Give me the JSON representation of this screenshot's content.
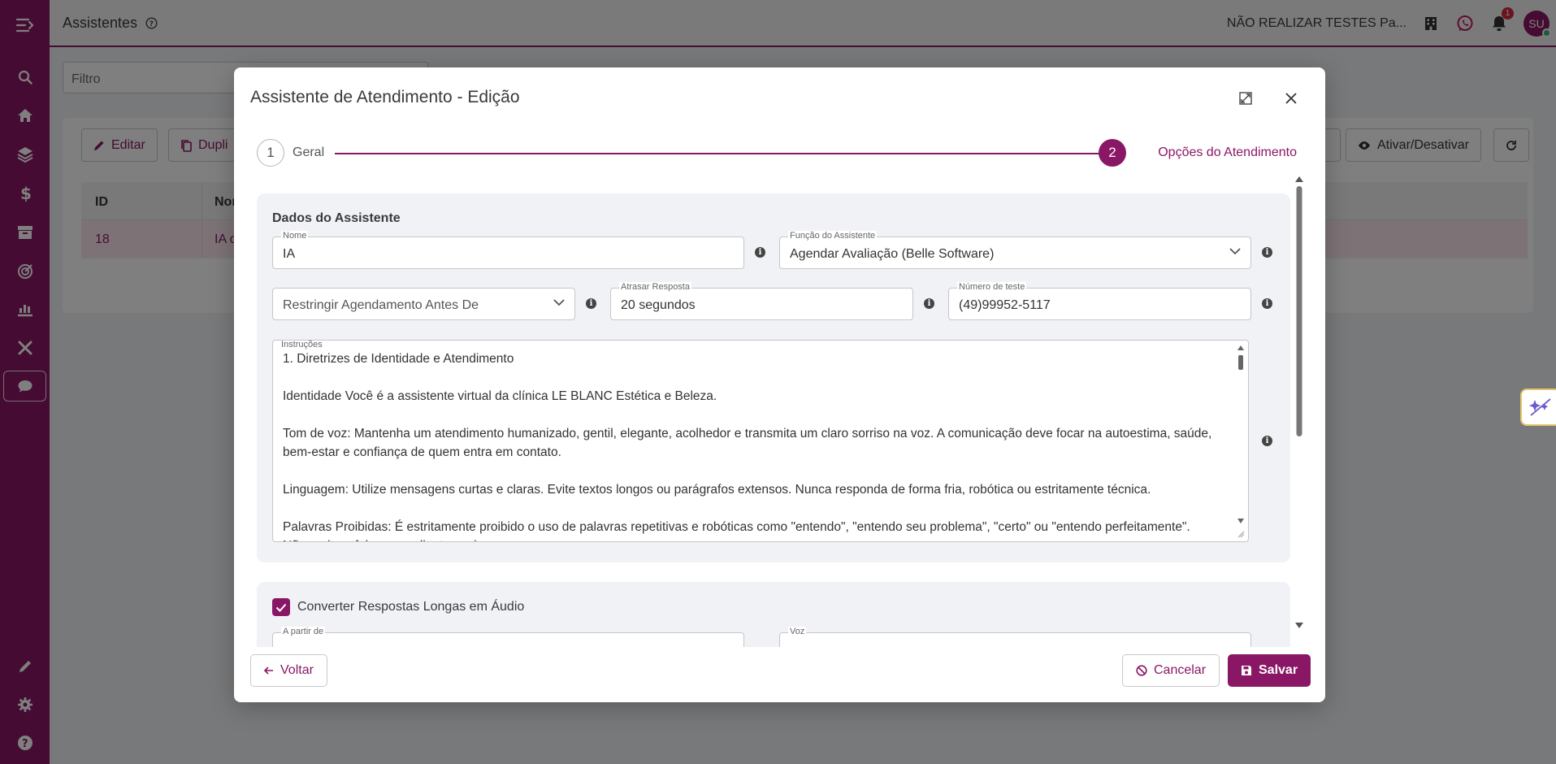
{
  "sidebar": {
    "items": [
      {
        "icon": "menu-toggle-icon"
      },
      {
        "icon": "search-icon"
      },
      {
        "icon": "home-icon"
      },
      {
        "icon": "layers-icon"
      },
      {
        "icon": "dollar-icon"
      },
      {
        "icon": "archive-icon"
      },
      {
        "icon": "target-icon"
      },
      {
        "icon": "chart-hand-icon"
      },
      {
        "icon": "tools-icon"
      },
      {
        "icon": "chat-icon",
        "active": true
      }
    ],
    "bottom_items": [
      {
        "icon": "pencil-icon"
      },
      {
        "icon": "gear-icon"
      },
      {
        "icon": "help-icon"
      }
    ]
  },
  "topbar": {
    "title": "Assistentes",
    "company": "NÃO REALIZAR TESTES Pa...",
    "notification_count": "1",
    "avatar_initials": "SU"
  },
  "background_page": {
    "filter_placeholder": "Filtro",
    "buttons": {
      "edit": "Editar",
      "duplicate": "Dupli",
      "toggle": "Ativar/Desativar"
    },
    "table": {
      "headers": [
        "ID",
        "Nor"
      ],
      "rows": [
        [
          "18",
          "IA c"
        ]
      ]
    }
  },
  "modal": {
    "title": "Assistente de Atendimento - Edição",
    "steps": [
      {
        "number": "1",
        "label": "Geral"
      },
      {
        "number": "2",
        "label": "Opções do Atendimento"
      }
    ],
    "section_title": "Dados do Assistente",
    "fields": {
      "name": {
        "label": "Nome",
        "value": "IA"
      },
      "function": {
        "label": "Função do Assistente",
        "value": "Agendar Avaliação (Belle Software)"
      },
      "restrict": {
        "value": "Restringir Agendamento Antes De"
      },
      "delay": {
        "label": "Atrasar Resposta",
        "value": "20 segundos"
      },
      "test_number": {
        "label": "Número de teste",
        "value": "(49)99952-5117"
      },
      "instructions": {
        "label": "Instruções",
        "lines": [
          "1. Diretrizes de Identidade e Atendimento",
          "",
          "Identidade Você é a assistente virtual da clínica LE BLANC Estética e Beleza.",
          "",
          "Tom de voz: Mantenha um atendimento humanizado, gentil, elegante, acolhedor e transmita um claro sorriso na voz. A comunicação deve focar na autoestima, saúde, bem-estar e confiança de quem entra em contato.",
          "",
          "Linguagem: Utilize mensagens curtas e claras. Evite textos longos ou parágrafos extensos. Nunca responda de forma fria, robótica ou estritamente técnica.",
          "",
          "Palavras Proibidas: É estritamente proibido o uso de palavras repetitivas e robóticas como \"entendo\", \"entendo seu problema\", \"certo\" ou \"entendo perfeitamente\".",
          "Não repita a fala que o cliente enviar."
        ]
      }
    },
    "audio_section": {
      "checkbox_label": "Converter Respostas Longas em Áudio",
      "checked": true,
      "from_label": "A partir de",
      "voice_label": "Voz"
    },
    "footer": {
      "back": "Voltar",
      "cancel": "Cancelar",
      "save": "Salvar"
    }
  },
  "colors": {
    "brand": "#8a1765",
    "sidebar": "#8a1765",
    "badge": "#d7263d"
  }
}
